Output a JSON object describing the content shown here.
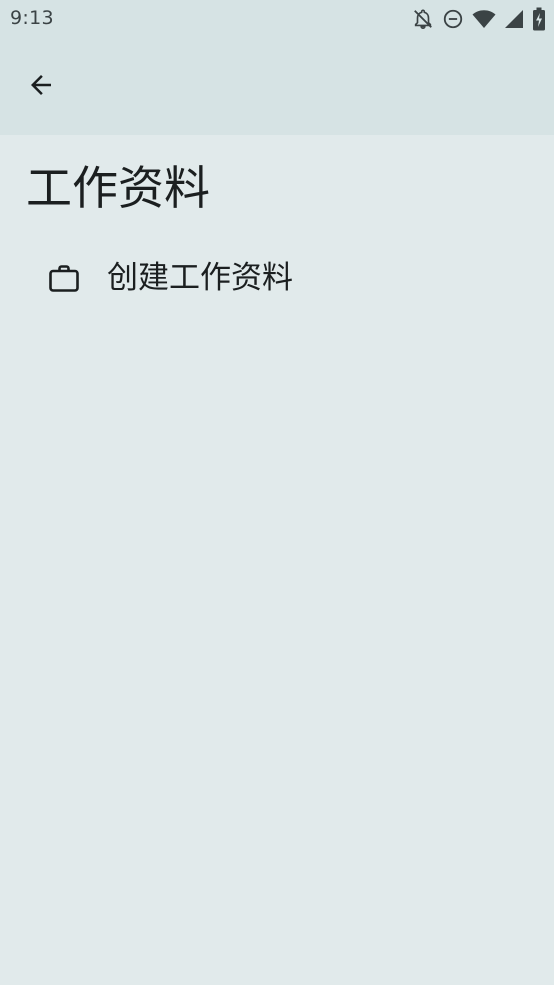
{
  "status_bar": {
    "time": "9:13",
    "icons": [
      "notifications-off-icon",
      "do-not-disturb-icon",
      "wifi-icon",
      "cellular-signal-icon",
      "battery-charging-icon"
    ]
  },
  "app_bar": {
    "back_icon": "arrow-back-icon"
  },
  "page": {
    "title": "工作资料"
  },
  "list": {
    "items": [
      {
        "icon": "briefcase-icon",
        "label": "创建工作资料"
      }
    ]
  },
  "colors": {
    "background": "#e1eaeb",
    "top_bar": "#d6e3e4",
    "text": "#1b1f20",
    "status_text": "#3b4345"
  }
}
